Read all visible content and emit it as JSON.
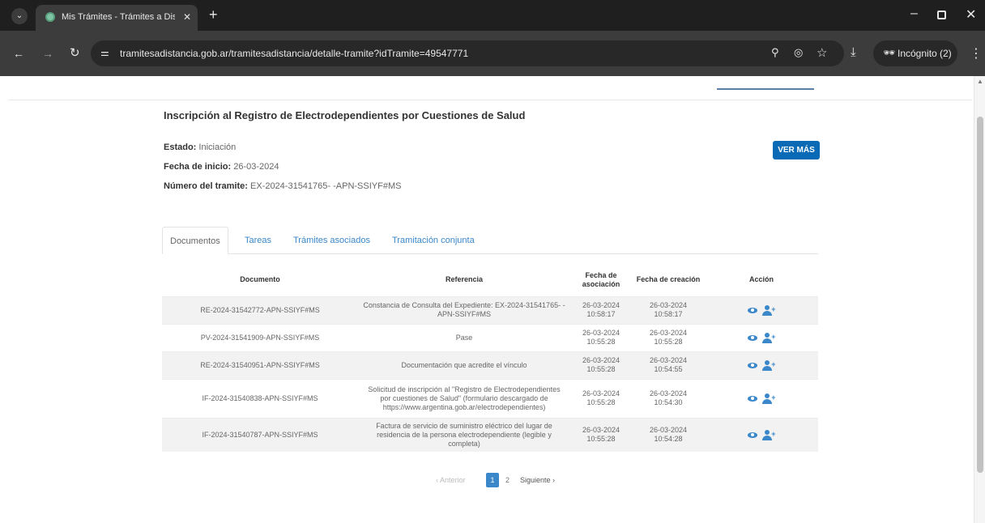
{
  "browser": {
    "tab_title": "Mis Trámites - Trámites a Dista",
    "tab_close": "✕",
    "new_tab": "+",
    "url": "tramitesadistancia.gob.ar/tramitesadistancia/detalle-tramite?idTramite=49547771",
    "incognito_label": "Incógnito (2)",
    "icons": [
      "chevron-down-icon",
      "favicon-icon",
      "close-icon",
      "plus-icon",
      "minimize-icon",
      "maximize-icon",
      "window-close-icon",
      "back-icon",
      "forward-icon",
      "reload-icon",
      "site-info-icon",
      "zoom-icon",
      "eye-off-icon",
      "star-icon",
      "download-icon",
      "incognito-icon",
      "kebab-menu-icon"
    ]
  },
  "page": {
    "title": "Inscripción al Registro de Electrodependientes por Cuestiones de Salud",
    "estado_label": "Estado:",
    "estado_value": "Iniciación",
    "fecha_label": "Fecha de inicio:",
    "fecha_value": "26-03-2024",
    "numero_label": "Número del tramite:",
    "numero_value": "EX-2024-31541765- -APN-SSIYF#MS",
    "ver_mas": "VER MÁS",
    "accent_color": "#0a6ab5",
    "link_color": "#3a87c9"
  },
  "tabs": [
    {
      "label": "Documentos",
      "active": true
    },
    {
      "label": "Tareas",
      "active": false
    },
    {
      "label": "Trámites asociados",
      "active": false
    },
    {
      "label": "Tramitación conjunta",
      "active": false
    }
  ],
  "table": {
    "headers": [
      "Documento",
      "Referencia",
      "Fecha de asociación",
      "Fecha de creación",
      "Acción"
    ],
    "rows": [
      {
        "documento": "RE-2024-31542772-APN-SSIYF#MS",
        "referencia": "Constancia de Consulta del Expediente: EX-2024-31541765- -APN-SSIYF#MS",
        "asociacion_fecha": "26-03-2024",
        "asociacion_hora": "10:58:17",
        "creacion_fecha": "26-03-2024",
        "creacion_hora": "10:58:17"
      },
      {
        "documento": "PV-2024-31541909-APN-SSIYF#MS",
        "referencia": "Pase",
        "asociacion_fecha": "26-03-2024",
        "asociacion_hora": "10:55:28",
        "creacion_fecha": "26-03-2024",
        "creacion_hora": "10:55:28"
      },
      {
        "documento": "RE-2024-31540951-APN-SSIYF#MS",
        "referencia": "Documentación que acredite el vínculo",
        "asociacion_fecha": "26-03-2024",
        "asociacion_hora": "10:55:28",
        "creacion_fecha": "26-03-2024",
        "creacion_hora": "10:54:55"
      },
      {
        "documento": "IF-2024-31540838-APN-SSIYF#MS",
        "referencia": "Solicitud de inscripción al \"Registro de Electrodependientes por cuestiones de Salud\" (formulario descargado de https://www.argentina.gob.ar/electrodependientes)",
        "asociacion_fecha": "26-03-2024",
        "asociacion_hora": "10:55:28",
        "creacion_fecha": "26-03-2024",
        "creacion_hora": "10:54:30"
      },
      {
        "documento": "IF-2024-31540787-APN-SSIYF#MS",
        "referencia": "Factura de servicio de suministro eléctrico del lugar de residencia de la persona electrodependiente (legible y completa)",
        "asociacion_fecha": "26-03-2024",
        "asociacion_hora": "10:55:28",
        "creacion_fecha": "26-03-2024",
        "creacion_hora": "10:54:28"
      }
    ]
  },
  "pagination": {
    "prev": "‹ Anterior",
    "page1": "1",
    "page2": "2",
    "next": "Siguiente ›"
  }
}
